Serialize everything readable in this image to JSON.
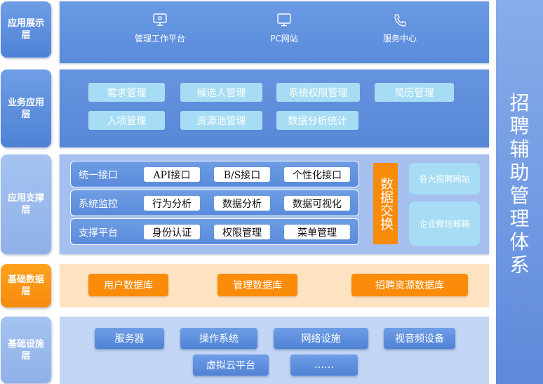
{
  "layers": {
    "presentation": {
      "label": "应用展示层",
      "items": [
        {
          "label": "管理工作平台",
          "icon": "monitor-icon"
        },
        {
          "label": "PC网站",
          "icon": "desktop-icon"
        },
        {
          "label": "服务中心",
          "icon": "phone-icon"
        }
      ]
    },
    "business": {
      "label": "业务应用层",
      "items": [
        "需求管理",
        "候选人管理",
        "系统权限管理",
        "简历管理",
        "入项管理",
        "资源池管理",
        "数据分析统计"
      ]
    },
    "support": {
      "label": "应用支撑层",
      "rows": [
        {
          "label": "统一接口",
          "items": [
            "API接口",
            "B/S接口",
            "个性化接口"
          ]
        },
        {
          "label": "系统监控",
          "items": [
            "行为分析",
            "数据分析",
            "数据可视化"
          ]
        },
        {
          "label": "支撑平台",
          "items": [
            "身份认证",
            "权限管理",
            "菜单管理"
          ]
        }
      ],
      "exchange": "数据交换",
      "external": [
        "各大招聘网站",
        "企业微信邮箱"
      ]
    },
    "data": {
      "label": "基础数据层",
      "items": [
        "用户数据库",
        "管理数据库",
        "招聘资源数据库"
      ]
    },
    "infrastructure": {
      "label": "基础设施层",
      "items": [
        "服务器",
        "操作系统",
        "网络设施",
        "视音频设备",
        "虚拟云平台",
        "……"
      ]
    }
  },
  "side_title": "招聘辅助管理体系",
  "colors": {
    "primary_blue": "#5a8bdb",
    "pale_blue": "#a5c0ef",
    "cyan_chip": "#a7ddf4",
    "orange": "#f98b0a",
    "cream": "#fde3c2"
  }
}
